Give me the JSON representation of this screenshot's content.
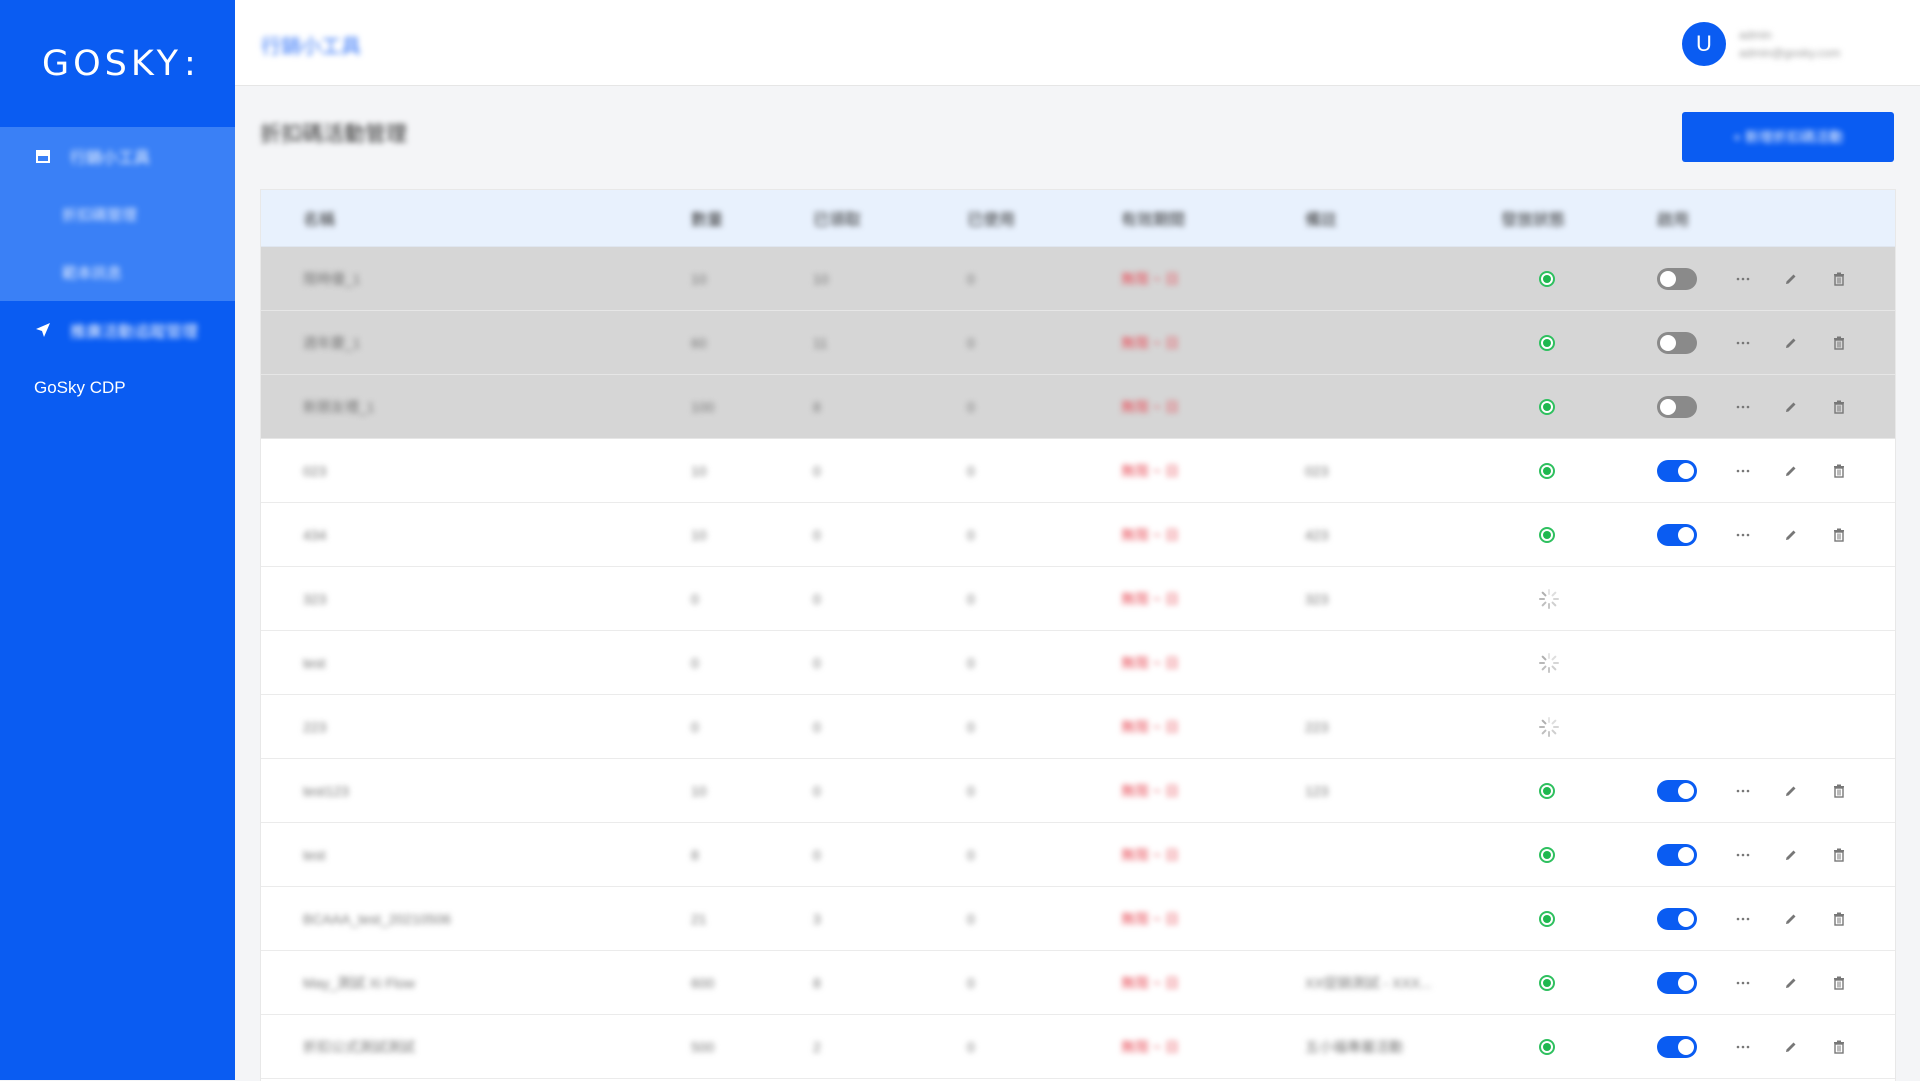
{
  "sidebar": {
    "logo": "GOSKY",
    "logo_suffix": ":",
    "groups": [
      {
        "label": "行銷小工具",
        "icon": "store-icon",
        "children": [
          {
            "label": "折扣碼管理"
          },
          {
            "label": "範本訊息"
          }
        ]
      },
      {
        "label": "推廣活動追蹤管理",
        "icon": "send-icon"
      }
    ],
    "plain_item": "GoSky CDP"
  },
  "topbar": {
    "breadcrumb": "行銷小工具",
    "avatar_letter": "U",
    "user_name": "admin",
    "user_email": "admin@gosky.com"
  },
  "page": {
    "title": "折扣碼活動管理",
    "add_button": "+ 新增折扣碼活動"
  },
  "table": {
    "columns": [
      "名稱",
      "數量",
      "已領取",
      "已使用",
      "有效期間",
      "備註",
      "發放狀態",
      "啟用"
    ],
    "rows": [
      {
        "name": "限時優_1",
        "qty": "10",
        "used": "10",
        "rec": "0",
        "time": "無限 ~ 日",
        "note": "",
        "status": "active",
        "enabled": "off",
        "shaded": true
      },
      {
        "name": "週年慶_1",
        "qty": "60",
        "used": "11",
        "rec": "0",
        "time": "無限 ~ 日",
        "note": "",
        "status": "active",
        "enabled": "off",
        "shaded": true
      },
      {
        "name": "新朋友禮_1",
        "qty": "100",
        "used": "8",
        "rec": "0",
        "time": "無限 ~ 日",
        "note": "",
        "status": "active",
        "enabled": "off",
        "shaded": true
      },
      {
        "name": "023",
        "qty": "10",
        "used": "0",
        "rec": "0",
        "time": "無限 ~ 日",
        "note": "023",
        "status": "active",
        "enabled": "on",
        "shaded": false
      },
      {
        "name": "434",
        "qty": "10",
        "used": "0",
        "rec": "0",
        "time": "無限 ~ 日",
        "note": "423",
        "status": "active",
        "enabled": "on",
        "shaded": false
      },
      {
        "name": "323",
        "qty": "0",
        "used": "0",
        "rec": "0",
        "time": "無限 ~ 日",
        "note": "323",
        "status": "loading",
        "enabled": "",
        "shaded": false
      },
      {
        "name": "test",
        "qty": "0",
        "used": "0",
        "rec": "0",
        "time": "無限 ~ 日",
        "note": "",
        "status": "loading",
        "enabled": "",
        "shaded": false
      },
      {
        "name": "223",
        "qty": "0",
        "used": "0",
        "rec": "0",
        "time": "無限 ~ 日",
        "note": "223",
        "status": "loading",
        "enabled": "",
        "shaded": false
      },
      {
        "name": "test123",
        "qty": "10",
        "used": "0",
        "rec": "0",
        "time": "無限 ~ 日",
        "note": "123",
        "status": "active",
        "enabled": "on",
        "shaded": false
      },
      {
        "name": "test",
        "qty": "8",
        "used": "0",
        "rec": "0",
        "time": "無限 ~ 日",
        "note": "",
        "status": "active",
        "enabled": "on",
        "shaded": false
      },
      {
        "name": "BCAAA_test_20210506",
        "qty": "21",
        "used": "3",
        "rec": "0",
        "time": "無限 ~ 日",
        "note": "",
        "status": "active",
        "enabled": "on",
        "shaded": false
      },
      {
        "name": "May_測試 Xi Flow",
        "qty": "600",
        "used": "8",
        "rec": "0",
        "time": "無限 ~ 日",
        "note": "XX促銷測試 - XXX...",
        "status": "active",
        "enabled": "on",
        "shaded": false
      },
      {
        "name": "折扣公式測試測試",
        "qty": "500",
        "used": "2",
        "rec": "0",
        "time": "無限 ~ 日",
        "note": "五小福專屬活動",
        "status": "active",
        "enabled": "on",
        "shaded": false
      }
    ]
  },
  "colors": {
    "primary": "#0a5cf2",
    "status_green": "#1fb84f",
    "red_text": "#e8505b"
  }
}
